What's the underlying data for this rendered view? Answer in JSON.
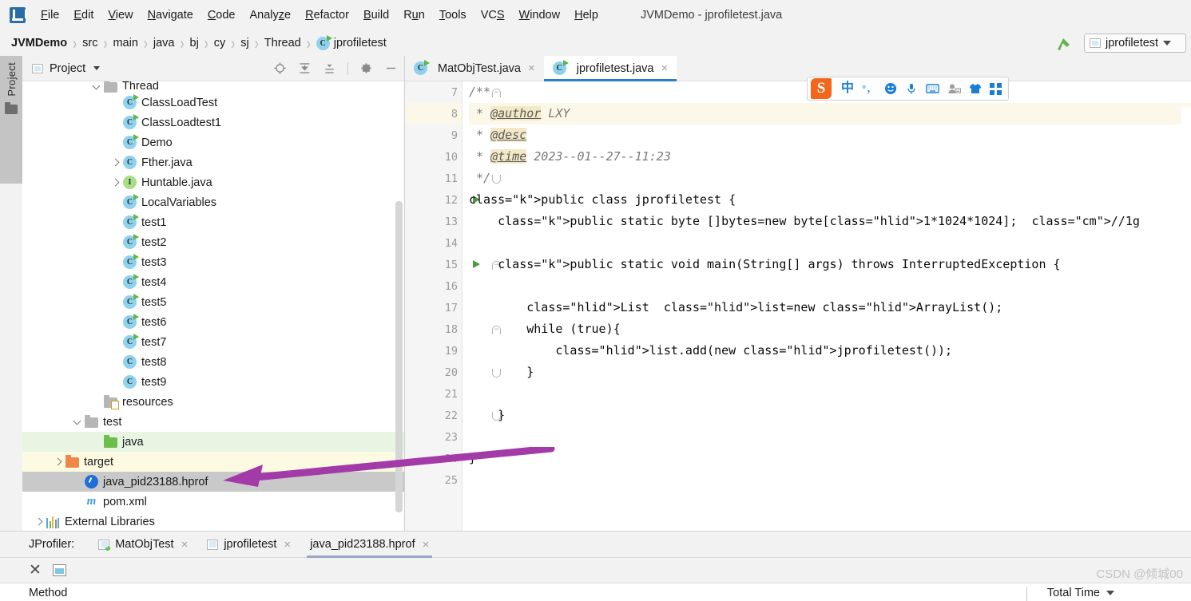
{
  "window": {
    "title": "JVMDemo - jprofiletest.java"
  },
  "menubar": {
    "items": [
      {
        "label": "File",
        "mnemonic": "F"
      },
      {
        "label": "Edit",
        "mnemonic": "E"
      },
      {
        "label": "View",
        "mnemonic": "V"
      },
      {
        "label": "Navigate",
        "mnemonic": "N"
      },
      {
        "label": "Code",
        "mnemonic": "C"
      },
      {
        "label": "Analyze",
        "mnemonic": "z"
      },
      {
        "label": "Refactor",
        "mnemonic": "R"
      },
      {
        "label": "Build",
        "mnemonic": "B"
      },
      {
        "label": "Run",
        "mnemonic": "u"
      },
      {
        "label": "Tools",
        "mnemonic": "T"
      },
      {
        "label": "VCS",
        "mnemonic": "S"
      },
      {
        "label": "Window",
        "mnemonic": "W"
      },
      {
        "label": "Help",
        "mnemonic": "H"
      }
    ]
  },
  "breadcrumb": {
    "items": [
      "JVMDemo",
      "src",
      "main",
      "java",
      "bj",
      "cy",
      "sj",
      "Thread",
      "jprofiletest"
    ],
    "separator": "›"
  },
  "run_config": {
    "name": "jprofiletest"
  },
  "left_rail": {
    "tab_label": "Project"
  },
  "project_panel": {
    "title": "Project",
    "tools": [
      "locate-icon",
      "expand-all-icon",
      "collapse-all-icon",
      "settings-gear-icon",
      "hide-icon"
    ],
    "tree": [
      {
        "label": "Thread",
        "indent": 4,
        "icon": "folder",
        "chevron": "down",
        "highlight": "none",
        "cutoff": true
      },
      {
        "label": "ClassLoadTest",
        "indent": 5,
        "icon": "class-run",
        "chevron": "none",
        "highlight": "none"
      },
      {
        "label": "ClassLoadtest1",
        "indent": 5,
        "icon": "class-run",
        "chevron": "none",
        "highlight": "none"
      },
      {
        "label": "Demo",
        "indent": 5,
        "icon": "class-run",
        "chevron": "none",
        "highlight": "none"
      },
      {
        "label": "Fther.java",
        "indent": 5,
        "icon": "class",
        "chevron": "right",
        "highlight": "none"
      },
      {
        "label": "Huntable.java",
        "indent": 5,
        "icon": "interface",
        "chevron": "right",
        "highlight": "none"
      },
      {
        "label": "LocalVariables",
        "indent": 5,
        "icon": "class-run",
        "chevron": "none",
        "highlight": "none"
      },
      {
        "label": "test1",
        "indent": 5,
        "icon": "class-run",
        "chevron": "none",
        "highlight": "none"
      },
      {
        "label": "test2",
        "indent": 5,
        "icon": "class-run",
        "chevron": "none",
        "highlight": "none"
      },
      {
        "label": "test3",
        "indent": 5,
        "icon": "class-run",
        "chevron": "none",
        "highlight": "none"
      },
      {
        "label": "test4",
        "indent": 5,
        "icon": "class-run",
        "chevron": "none",
        "highlight": "none"
      },
      {
        "label": "test5",
        "indent": 5,
        "icon": "class-run",
        "chevron": "none",
        "highlight": "none"
      },
      {
        "label": "test6",
        "indent": 5,
        "icon": "class-run",
        "chevron": "none",
        "highlight": "none"
      },
      {
        "label": "test7",
        "indent": 5,
        "icon": "class-run",
        "chevron": "none",
        "highlight": "none"
      },
      {
        "label": "test8",
        "indent": 5,
        "icon": "class",
        "chevron": "none",
        "highlight": "none"
      },
      {
        "label": "test9",
        "indent": 5,
        "icon": "class",
        "chevron": "none",
        "highlight": "none"
      },
      {
        "label": "resources",
        "indent": 4,
        "icon": "folder-resources",
        "chevron": "none",
        "highlight": "none"
      },
      {
        "label": "test",
        "indent": 3,
        "icon": "folder",
        "chevron": "down",
        "highlight": "none"
      },
      {
        "label": "java",
        "indent": 4,
        "icon": "folder-green",
        "chevron": "none",
        "highlight": "green"
      },
      {
        "label": "target",
        "indent": 2,
        "icon": "folder-orange",
        "chevron": "right",
        "highlight": "yellow"
      },
      {
        "label": "java_pid23188.hprof",
        "indent": 3,
        "icon": "hprof",
        "chevron": "none",
        "highlight": "gray"
      },
      {
        "label": "pom.xml",
        "indent": 3,
        "icon": "maven",
        "chevron": "none",
        "highlight": "none"
      },
      {
        "label": "External Libraries",
        "indent": 1,
        "icon": "libraries",
        "chevron": "right",
        "highlight": "none"
      }
    ]
  },
  "editor": {
    "tabs": [
      {
        "label": "MatObjTest.java",
        "icon": "class-run",
        "active": false
      },
      {
        "label": "jprofiletest.java",
        "icon": "class-run",
        "active": true
      }
    ],
    "first_line_number": 7,
    "caret_line": 8,
    "lines": [
      {
        "n": 7,
        "text": "/**",
        "fold": "top"
      },
      {
        "n": 8,
        "text": " * @author LXY",
        "hl": true
      },
      {
        "n": 9,
        "text": " * @desc"
      },
      {
        "n": 10,
        "text": " * @time 2023--01--27--11:23"
      },
      {
        "n": 11,
        "text": " */",
        "fold": "bottom"
      },
      {
        "n": 12,
        "text": "public class jprofiletest {",
        "run": true
      },
      {
        "n": 13,
        "text": "    public static byte []bytes=new byte[1*1024*1024];  //1g"
      },
      {
        "n": 14,
        "text": ""
      },
      {
        "n": 15,
        "text": "    public static void main(String[] args) throws InterruptedException {",
        "run": true,
        "fold": "top"
      },
      {
        "n": 16,
        "text": ""
      },
      {
        "n": 17,
        "text": "        List  list=new ArrayList();"
      },
      {
        "n": 18,
        "text": "        while (true){",
        "fold": "top"
      },
      {
        "n": 19,
        "text": "            list.add(new jprofiletest());"
      },
      {
        "n": 20,
        "text": "        }",
        "fold": "bottom"
      },
      {
        "n": 21,
        "text": ""
      },
      {
        "n": 22,
        "text": "    }",
        "fold": "bottom"
      },
      {
        "n": 23,
        "text": ""
      },
      {
        "n": 24,
        "text": "}"
      },
      {
        "n": 25,
        "text": ""
      }
    ]
  },
  "ime_toolbar": {
    "logo": "sogou-logo",
    "items": [
      "chinese-mode-icon",
      "punctuation-icon",
      "emoji-icon",
      "voice-input-icon",
      "soft-keyboard-icon",
      "user-icon",
      "skin-icon",
      "apps-grid-icon"
    ],
    "labels": [
      "中",
      "°，"
    ]
  },
  "annotation": {
    "arrow_color": "#a23ba8",
    "target": "java_pid23188.hprof"
  },
  "bottom_panel": {
    "label": "JProfiler:",
    "tabs": [
      {
        "label": "MatObjTest",
        "active": false,
        "running": true
      },
      {
        "label": "jprofiletest",
        "active": false,
        "running": false
      },
      {
        "label": "java_pid23188.hprof",
        "active": true,
        "running": false,
        "noicon": true
      }
    ],
    "toolbar": [
      "close-icon",
      "restore-window-icon"
    ],
    "table_columns": [
      {
        "label": "Method"
      },
      {
        "label": "Total Time",
        "sort": "desc"
      }
    ]
  },
  "watermark": {
    "text": "CSDN @倾城00"
  },
  "colors": {
    "accent": "#2a7ec4",
    "run_green": "#4a9c3c",
    "keyword_blue": "#0033b3",
    "highlight_yellow": "#f8ecc8",
    "annotation_purple": "#a23ba8"
  }
}
